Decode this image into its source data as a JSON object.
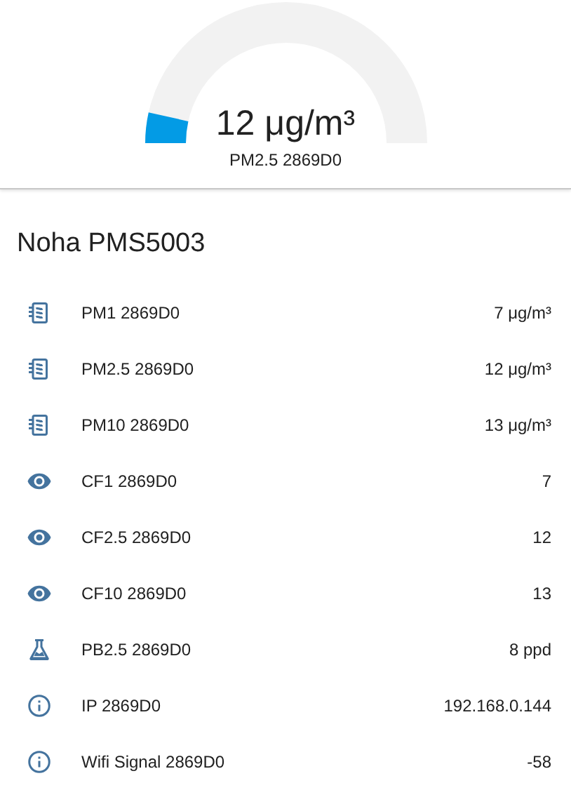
{
  "gauge": {
    "value": "12 μg/m³",
    "name": "PM2.5 2869D0"
  },
  "card": {
    "title": "Noha PMS5003",
    "rows": [
      {
        "kind": "chip",
        "name": "PM1 2869D0",
        "value": "7 μg/m³"
      },
      {
        "kind": "chip",
        "name": "PM2.5 2869D0",
        "value": "12 μg/m³"
      },
      {
        "kind": "chip",
        "name": "PM10 2869D0",
        "value": "13 μg/m³"
      },
      {
        "kind": "eye",
        "name": "CF1 2869D0",
        "value": "7"
      },
      {
        "kind": "eye",
        "name": "CF2.5 2869D0",
        "value": "12"
      },
      {
        "kind": "eye",
        "name": "CF10 2869D0",
        "value": "13"
      },
      {
        "kind": "flask",
        "name": "PB2.5 2869D0",
        "value": "8 ppd"
      },
      {
        "kind": "info",
        "name": "IP 2869D0",
        "value": "192.168.0.144"
      },
      {
        "kind": "info",
        "name": "Wifi Signal 2869D0",
        "value": "-58"
      }
    ]
  }
}
